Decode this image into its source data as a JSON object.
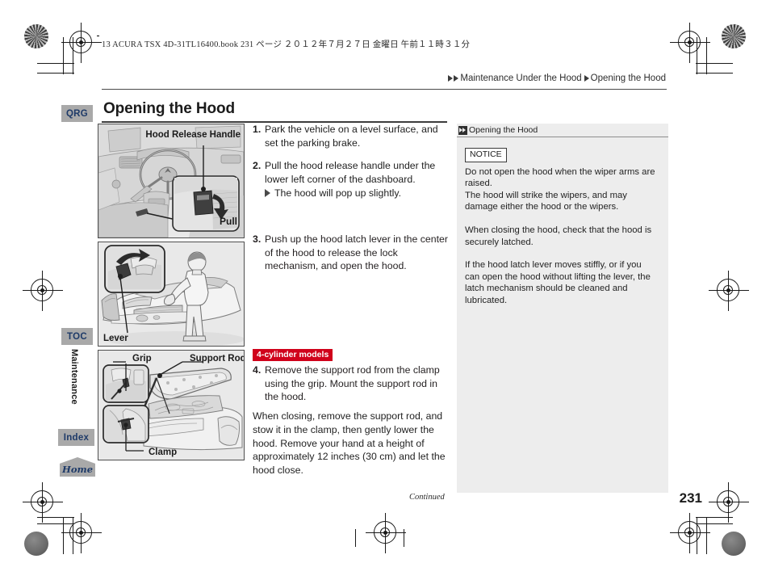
{
  "print_header": {
    "book_line": "13 ACURA TSX 4D-31TL16400.book   231 ページ   ２０１２年７月２７日   金曜日   午前１１時３１分"
  },
  "breadcrumb": {
    "section": "Maintenance Under the Hood",
    "page": "Opening the Hood"
  },
  "page": {
    "title": "Opening the Hood",
    "folio": "231",
    "continued": "Continued"
  },
  "nav_rail": {
    "qrg": "QRG",
    "toc": "TOC",
    "chapter": "Maintenance",
    "index": "Index",
    "home": "Home"
  },
  "figures": [
    {
      "id": "fig-hood-release-handle",
      "labels": [
        "Hood Release Handle",
        "Pull"
      ]
    },
    {
      "id": "fig-hood-latch-lever",
      "labels": [
        "Lever"
      ]
    },
    {
      "id": "fig-support-rod",
      "labels": [
        "Grip",
        "Support Rod",
        "Clamp"
      ]
    }
  ],
  "steps": [
    {
      "number": "1.",
      "text": "Park the vehicle on a level surface, and set the parking brake."
    },
    {
      "number": "2.",
      "text": "Pull the hood release handle under the lower left corner of the dashboard.",
      "sub": "The hood will pop up slightly."
    },
    {
      "number": "3.",
      "text": "Push up the hood latch lever in the center of the hood to release the lock mechanism, and open the hood."
    },
    {
      "number": "4.",
      "badge": "4-cylinder models",
      "text": "Remove the support rod from the clamp using the grip. Mount the support rod in the hood."
    }
  ],
  "closing_paragraph": "When closing, remove the support rod, and stow it in the clamp, then gently lower the hood. Remove your hand at a height of approximately 12 inches (30 cm) and let the hood close.",
  "side_panel": {
    "header": "Opening the Hood",
    "notice_label": "NOTICE",
    "paragraphs": [
      "Do not open the hood when the wiper arms are raised.",
      "The hood will strike the wipers, and may damage either the hood or the wipers.",
      "When closing the hood, check that the hood is securely latched.",
      "If the hood latch lever moves stiffly, or if you can open the hood without lifting the lever, the latch mechanism should be cleaned and lubricated."
    ]
  },
  "colors": {
    "badge_red": "#d0021b",
    "rail_gray": "#a9a9a9",
    "rail_text": "#1e3a68",
    "panel_gray": "#ededed"
  }
}
